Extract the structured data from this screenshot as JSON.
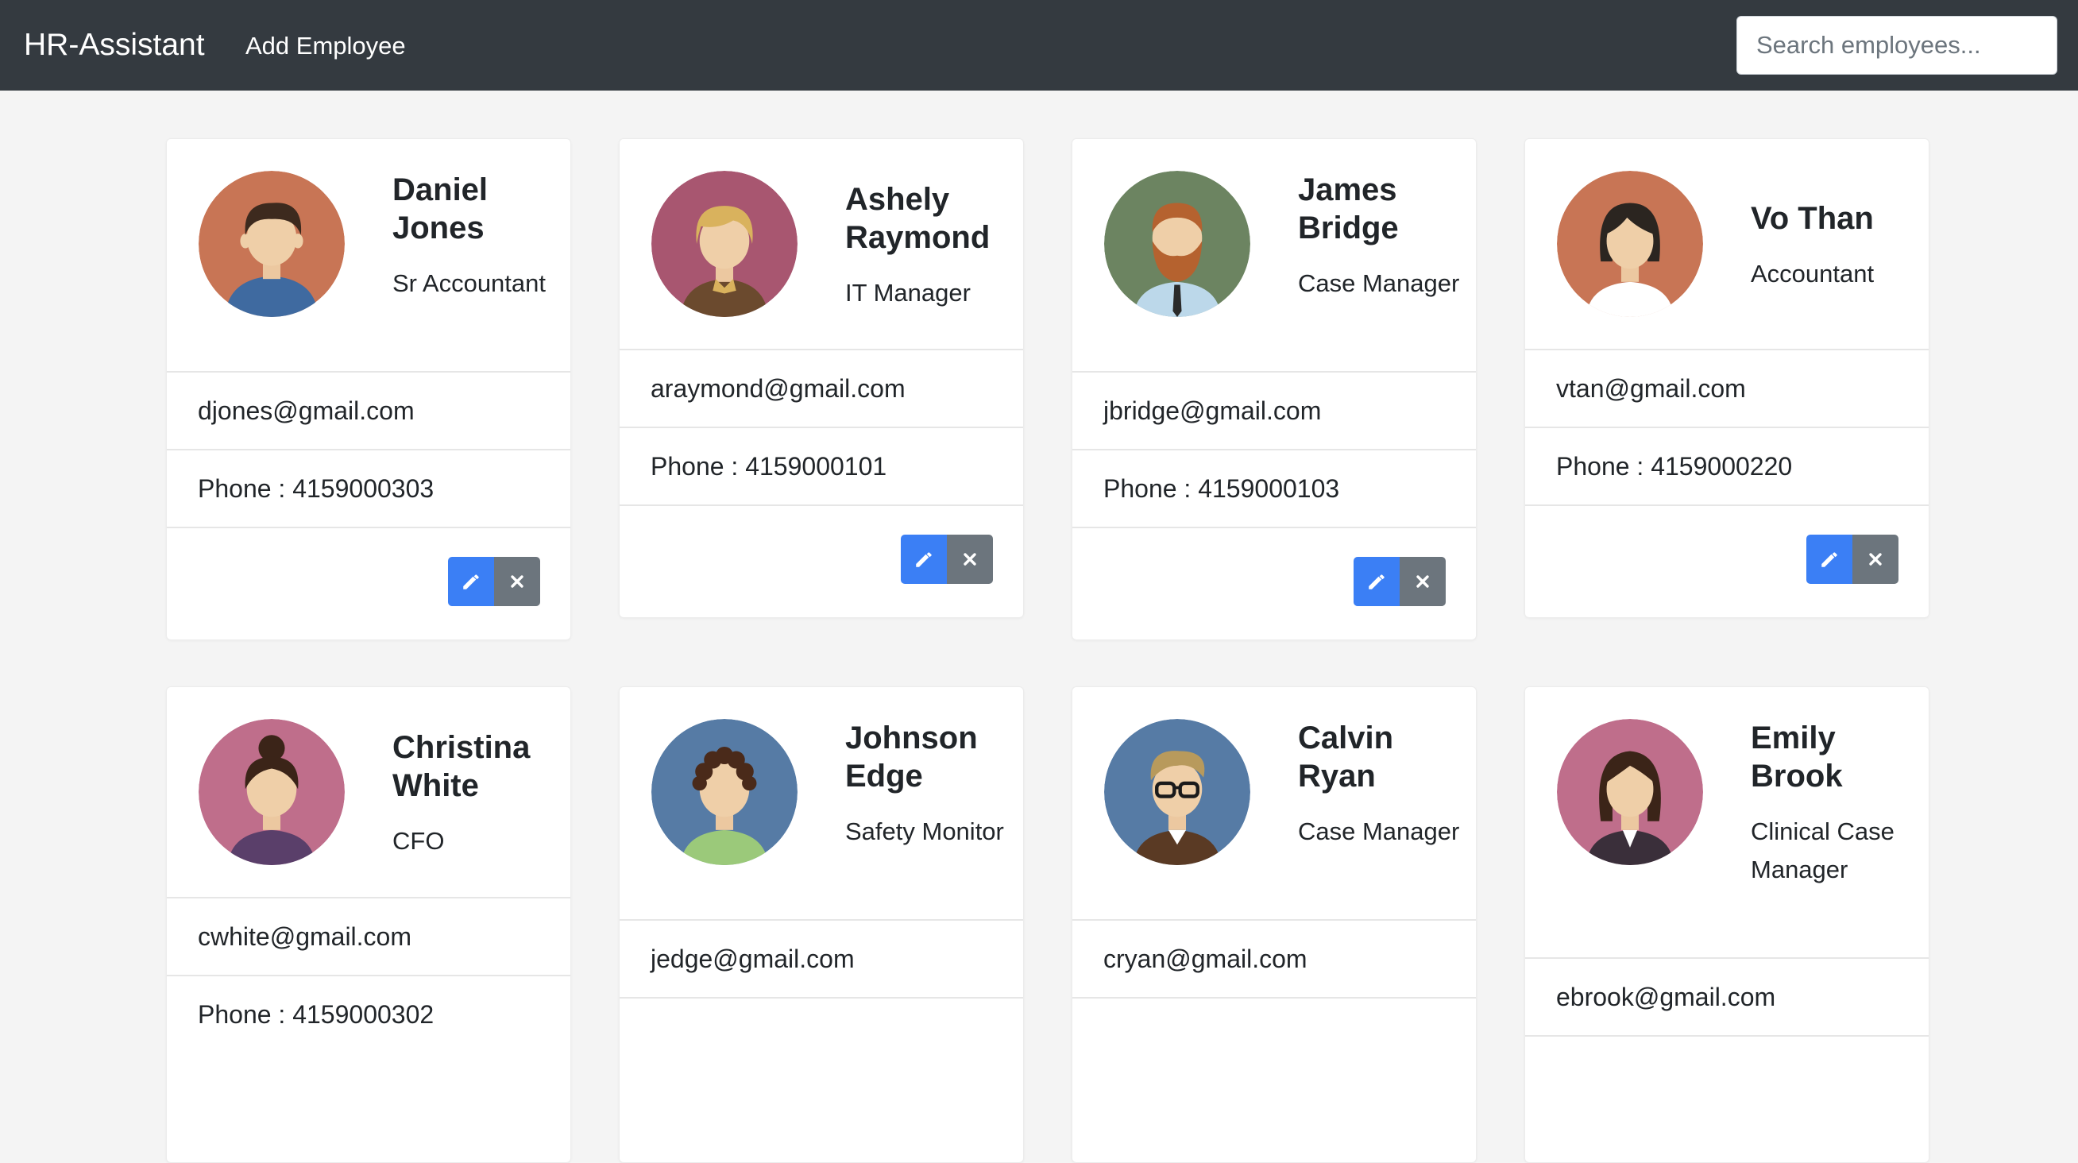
{
  "app": {
    "brand": "HR-Assistant",
    "nav_add": "Add Employee",
    "search_placeholder": "Search employees..."
  },
  "employees": [
    {
      "name": "Daniel Jones",
      "title": "Sr Accountant",
      "email": "djones@gmail.com",
      "phone": "Phone : 4159000303",
      "avatar_bg": "#c87555"
    },
    {
      "name": "Ashely Raymond",
      "title": "IT Manager",
      "email": "araymond@gmail.com",
      "phone": "Phone : 4159000101",
      "avatar_bg": "#a85670"
    },
    {
      "name": "James Bridge",
      "title": "Case Manager",
      "email": "jbridge@gmail.com",
      "phone": "Phone : 4159000103",
      "avatar_bg": "#6c8461"
    },
    {
      "name": "Vo Than",
      "title": "Accountant",
      "email": "vtan@gmail.com",
      "phone": "Phone : 4159000220",
      "avatar_bg": "#c87555"
    },
    {
      "name": "Christina White",
      "title": "CFO",
      "email": "cwhite@gmail.com",
      "phone": "Phone : 4159000302",
      "avatar_bg": "#bf6e8b"
    },
    {
      "name": "Johnson Edge",
      "title": "Safety Monitor",
      "email": "jedge@gmail.com",
      "phone": "",
      "avatar_bg": "#567ba5"
    },
    {
      "name": "Calvin Ryan",
      "title": "Case Manager",
      "email": "cryan@gmail.com",
      "phone": "",
      "avatar_bg": "#567ba5"
    },
    {
      "name": "Emily Brook",
      "title": "Clinical Case Manager",
      "email": "ebrook@gmail.com",
      "phone": "",
      "avatar_bg": "#bf6e8b"
    }
  ],
  "icons": {
    "edit": "pencil-icon",
    "delete": "close-icon"
  },
  "colors": {
    "navbar": "#343a40",
    "edit_button": "#3b7ff5",
    "delete_button": "#6c757d"
  }
}
